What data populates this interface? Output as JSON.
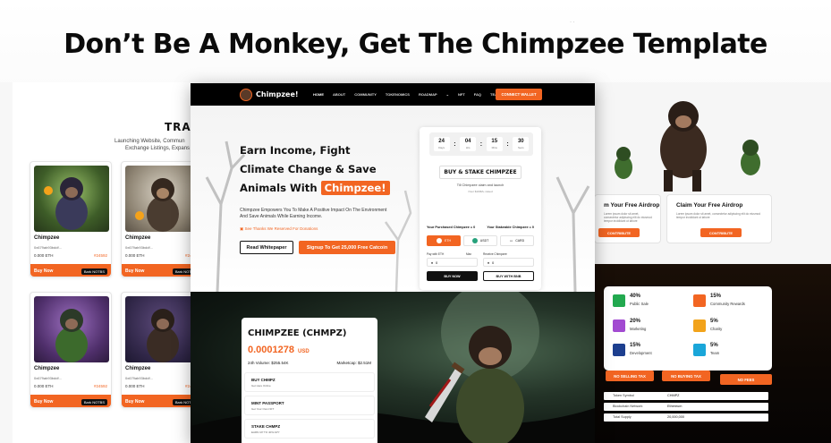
{
  "headline": "Don’t Be A Monkey, Get The Chimpzee Template",
  "left": {
    "section_title": "TRA",
    "text_lines": [
      "Launching Website, Commun",
      "Exchange Listings, Expans"
    ],
    "nft_cards": [
      {
        "name": "Chimpzee",
        "by": "0x679ab93bddf...",
        "price": "0.000 ETH",
        "alt_price": "#24592",
        "buy": "Buy Now",
        "bid": "Bark NOTBS"
      },
      {
        "name": "Chimpzee",
        "by": "0x679ab93bddf...",
        "price": "0.000 ETH",
        "alt_price": "#24590",
        "buy": "Buy Now",
        "bid": "Bark NOTBS"
      },
      {
        "name": "Chimpzee",
        "by": "0x679ab93bddf...",
        "price": "0.000 ETH",
        "alt_price": "#24592",
        "buy": "Buy Now",
        "bid": "Bark NOTBS"
      },
      {
        "name": "Chimpzee",
        "by": "0x679ab93bddf...",
        "price": "0.000 ETH",
        "alt_price": "#24592",
        "buy": "Buy Now",
        "bid": "Bark NOTBS"
      }
    ]
  },
  "main": {
    "brand": "Chimpzee!",
    "nav": [
      "HOME",
      "ABOUT",
      "COMMUNITY",
      "TOKENOMICS",
      "ROADMAP",
      "NFT",
      "FAQ",
      "TEAM"
    ],
    "connect": "CONNECT WALLET",
    "hero": {
      "line1": "Earn Income, Fight",
      "line2": "Climate Change & Save",
      "line3": "Animals With",
      "highlight": "Chimpzee!",
      "paragraph": "Chimpzee Empowers You To Make A Positive Impact On The Environment And Save Animals While Earning Income.",
      "note": "See Thanks We Reserved For Donations",
      "btn_whitepaper": "Read Whitepaper",
      "btn_signup": "Signup To Get 25,000 Free Catcoin"
    },
    "widget": {
      "timer": [
        {
          "value": "24",
          "label": "Days"
        },
        {
          "value": "04",
          "label": "Hrs"
        },
        {
          "value": "15",
          "label": "Mins"
        },
        {
          "value": "30",
          "label": "Secs"
        }
      ],
      "title": "BUY & STAKE CHIMPZEE",
      "subtitle1": "Till Chimpzee claim and launch",
      "subtitle2": "Over $100M+ raised",
      "purchased": "Your Purchased Chimpzee = 0",
      "stakeable": "Your Stakeable Chimpzee = 0",
      "tokens": [
        "ETH",
        "USDT",
        "CARD"
      ],
      "pay_label": "Pay with ETH",
      "max_label": "Max",
      "receive_label": "Receive Chimpzee",
      "pay_value": "0",
      "receive_value": "0",
      "buy_now": "BUY NOW",
      "buy_bnb": "BUY WITH BNB"
    },
    "token": {
      "name": "CHIMPZEE (CHMPZ)",
      "price": "0.0001278",
      "currency": "USD",
      "volume": "24h Volume: $255.54K",
      "marketcap": "Marketcap: $2.51M",
      "items": [
        {
          "title": "BUY CHMPZ",
          "sub": "Get Here Online"
        },
        {
          "title": "MINT PASSPORT",
          "sub": "Get Your Own NFT"
        },
        {
          "title": "STAKE CHMPZ",
          "sub": "EARN UP TO 40% APY"
        }
      ]
    }
  },
  "right": {
    "airdrops": [
      {
        "title": "m Your Free Airdrop",
        "desc": "Lorem ipsum dolor sit amet, consectetur adipiscing elit do eiusmod tempor incididunt ut labore",
        "button": "CONTRIBUTE"
      },
      {
        "title": "Claim Your Free Airdrop",
        "desc": "Lorem ipsum dolor sit amet, consectetur adipiscing elit do eiusmod tempor incididunt ut labore",
        "button": "CONTRIBUTE"
      }
    ],
    "allocation": [
      {
        "pct": "40%",
        "name": "Public Sale",
        "color": "#22a94f"
      },
      {
        "pct": "15%",
        "name": "Community Rewards",
        "color": "#f26522"
      },
      {
        "pct": "20%",
        "name": "Marketing",
        "color": "#a24bd1"
      },
      {
        "pct": "5%",
        "name": "Charity",
        "color": "#f2a31b"
      },
      {
        "pct": "15%",
        "name": "Development",
        "color": "#1d3f8f"
      },
      {
        "pct": "5%",
        "name": "Team",
        "color": "#1aa6d9"
      }
    ],
    "taxes": [
      "NO SELLING TAX",
      "NO BUYING TAX",
      "NO FEES"
    ],
    "info": [
      {
        "key": "Token Symbol",
        "value": "CHMPZ"
      },
      {
        "key": "Blockchain Network",
        "value": "Ethereum"
      },
      {
        "key": "Total Supply",
        "value": "20,000,000"
      }
    ]
  },
  "colors": {
    "accent": "#f26522",
    "dark": "#000000"
  }
}
